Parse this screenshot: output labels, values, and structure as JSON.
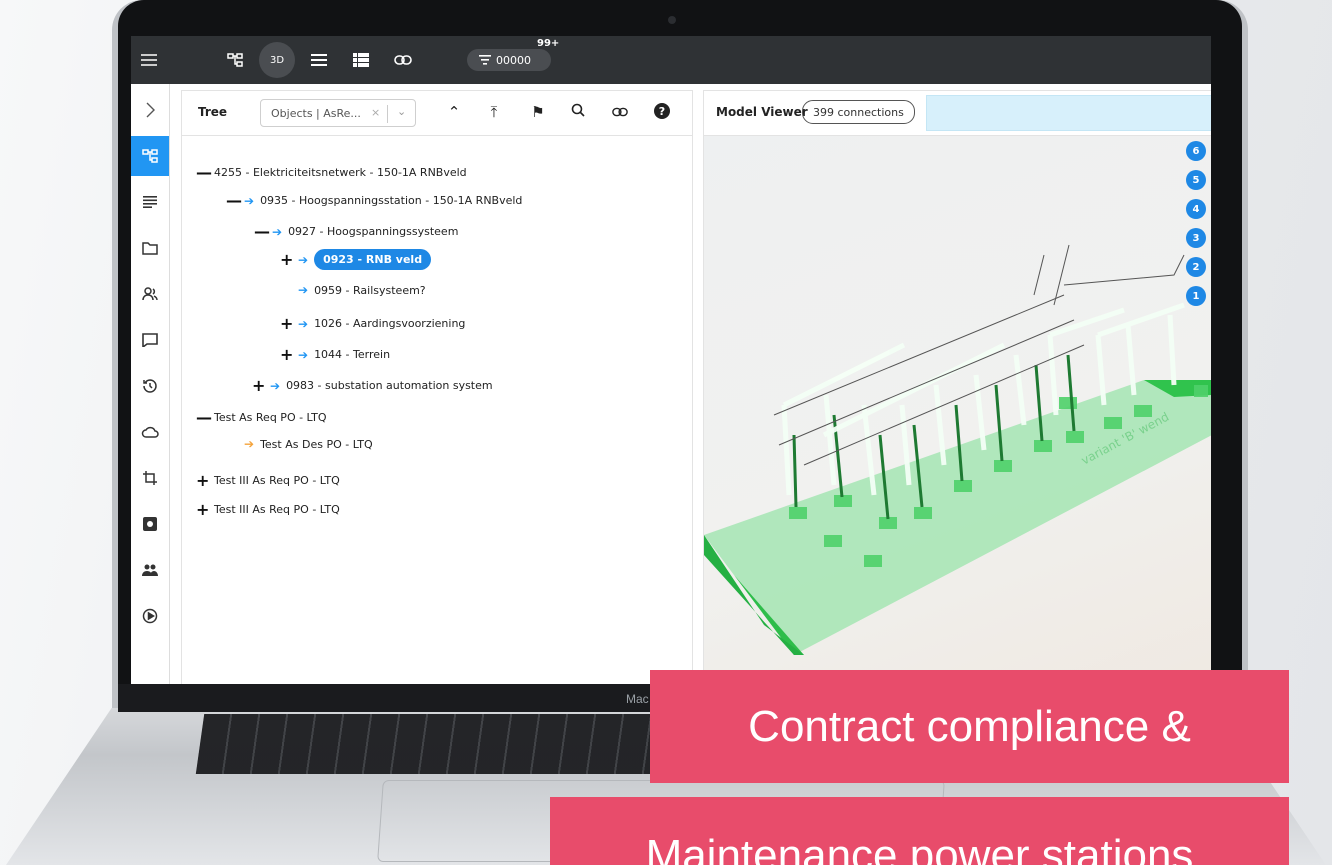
{
  "topbar": {
    "filter_value": "00000",
    "filter_badge": "99+",
    "view_3d_label": "3D"
  },
  "tree": {
    "title": "Tree",
    "select_value": "Objects | AsRe...",
    "nodes": [
      {
        "sign": "—",
        "arrow": "",
        "label": "4255 - Elektriciteitsnetwerk - 150-1A RNBveld"
      },
      {
        "sign": "—",
        "arrow": "blue",
        "label": "0935 - Hoogspanningsstation - 150-1A RNBveld"
      },
      {
        "sign": "—",
        "arrow": "blue",
        "label": "0927 - Hoogspanningssysteem"
      },
      {
        "sign": "+",
        "arrow": "blue",
        "label": "0923 - RNB veld",
        "selected": true
      },
      {
        "sign": "",
        "arrow": "blue",
        "label": "0959 - Railsysteem?"
      },
      {
        "sign": "+",
        "arrow": "blue",
        "label": "1026 - Aardingsvoorziening"
      },
      {
        "sign": "+",
        "arrow": "blue",
        "label": "1044 - Terrein"
      },
      {
        "sign": "+",
        "arrow": "blue",
        "label": "0983 - substation automation system"
      },
      {
        "sign": "—",
        "arrow": "",
        "label": "Test As Req PO - LTQ"
      },
      {
        "sign": "",
        "arrow": "orange",
        "label": "Test As Des PO - LTQ"
      },
      {
        "sign": "+",
        "arrow": "",
        "label": "Test III As Req PO - LTQ"
      },
      {
        "sign": "+",
        "arrow": "",
        "label": "Test III As Req PO - LTQ"
      }
    ]
  },
  "model_viewer": {
    "title": "Model Viewer",
    "connections": "399 connections",
    "layers": [
      "6",
      "5",
      "4",
      "3",
      "2",
      "1"
    ],
    "model_text": "variant 'B' wend"
  },
  "laptop_label": "Mac",
  "banners": {
    "line1": "Contract compliance &",
    "line2": "Maintenance power stations"
  },
  "colors": {
    "accent": "#1e88e5",
    "topbar": "#2f3235",
    "banner": "#e84c6b"
  }
}
